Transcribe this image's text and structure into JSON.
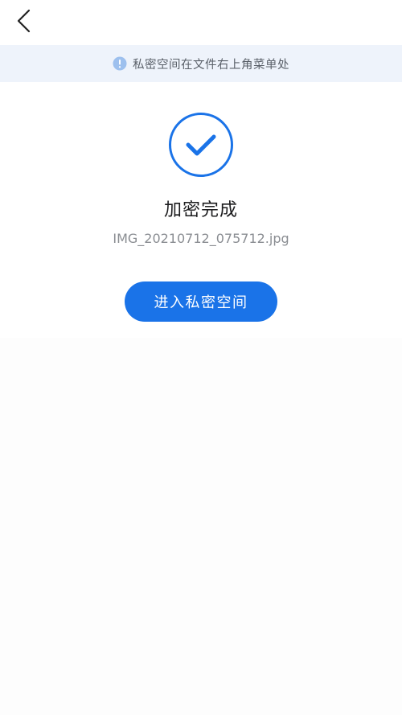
{
  "colors": {
    "accent": "#1a73e8",
    "banner_bg": "#eef3fb",
    "info_icon": "#9dc0ee"
  },
  "header": {
    "back_icon": "chevron-left-icon"
  },
  "banner": {
    "icon": "info-icon",
    "text": "私密空间在文件右上角菜单处"
  },
  "result": {
    "icon": "check-circle-icon",
    "title": "加密完成",
    "file_name": "IMG_20210712_075712.jpg"
  },
  "actions": {
    "enter_label": "进入私密空间"
  }
}
